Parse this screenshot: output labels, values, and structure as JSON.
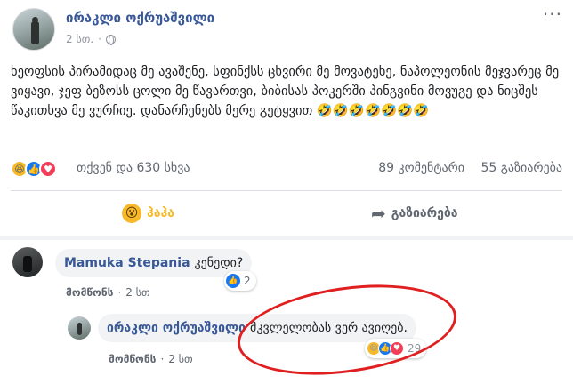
{
  "post": {
    "author": "ირაკლი ოქრუაშვილი",
    "time": "2 სთ.",
    "text": "ხეოფსის პირამიდაც მე ავაშენე, სფინქსს ცხვირი მე მოვატეხე, ნაპოლეონის მეჯვარეც მე ვიყავი, ჯეფ ბეზოსს ცოლი მე წავართვი, ბიბისას პოკერში პინგვინი მოვუგე და ნიცშეს წაკითხვა მე ვურჩიე. დანარჩენებს მერე გეტყვით 🤣🤣🤣🤣🤣🤣🤣"
  },
  "reactions": {
    "summary": "თქვენ და 630 სხვა",
    "comments": "89 კომენტარი",
    "shares": "55 გაზიარება"
  },
  "actions": {
    "haha": "ჰაჰა",
    "share": "გაზიარება"
  },
  "comments": [
    {
      "author": "Mamuka Stepania",
      "text": "კენედი?",
      "reaction_count": "2",
      "like_label": "მომწონს",
      "time": "2 სთ"
    },
    {
      "author": "ირაკლი ოქრუაშვილი",
      "text": "მკვლელობას ვერ ავიღებ.",
      "reaction_count": "29",
      "like_label": "მომწონს",
      "time": "2 სთ"
    }
  ],
  "colors": {
    "link_blue": "#385898",
    "haha_yellow": "#f7b928",
    "like_blue": "#1877f2",
    "love_red": "#f33e58",
    "annotation_red": "#e02020"
  }
}
